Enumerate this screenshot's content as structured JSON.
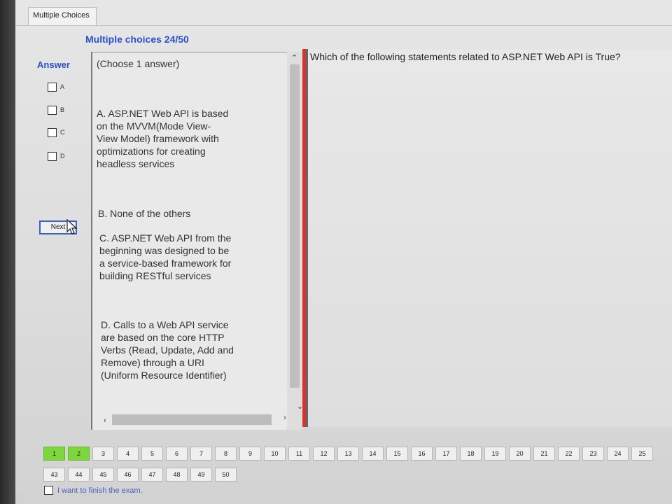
{
  "window": {
    "tab_title": "Multiple Choices"
  },
  "question_header": {
    "title": "Multiple choices 24/50"
  },
  "answer": {
    "label": "Answer",
    "choices": [
      {
        "letter": "A"
      },
      {
        "letter": "B"
      },
      {
        "letter": "C"
      },
      {
        "letter": "D"
      }
    ],
    "next_label": "Next"
  },
  "options_panel": {
    "instruction": "(Choose 1 answer)",
    "options": [
      "A. ASP.NET Web API is based on the MVVM(Mode View-View Model) framework with optimizations for creating headless services",
      "B. None of the others",
      "C. ASP.NET Web API from the beginning was designed to be a service-based framework for building RESTful services",
      "D. Calls to a Web API service are based on the core HTTP Verbs (Read, Update, Add and Remove) through a URI (Uniform Resource Identifier)"
    ]
  },
  "question": {
    "text": "Which of the following statements related to ASP.NET Web API is True?"
  },
  "navigation": {
    "row1": [
      "1",
      "2",
      "3",
      "4",
      "5",
      "6",
      "7",
      "8",
      "9",
      "10",
      "11",
      "12",
      "13",
      "14",
      "15",
      "16",
      "17",
      "18",
      "19",
      "20",
      "21",
      "22",
      "23",
      "24",
      "25"
    ],
    "row2": [
      "43",
      "44",
      "45",
      "46",
      "47",
      "48",
      "49",
      "50"
    ],
    "answered_count": 2
  },
  "finish": {
    "label": "I want to finish the exam."
  },
  "colors": {
    "accent": "#2a4fcf",
    "answered": "#7dd63b",
    "divider": "#d9332e"
  },
  "icons": [
    "checkbox-icon",
    "cursor-icon",
    "scroll-up-icon",
    "scroll-down-icon",
    "scroll-left-icon",
    "scroll-right-icon"
  ]
}
